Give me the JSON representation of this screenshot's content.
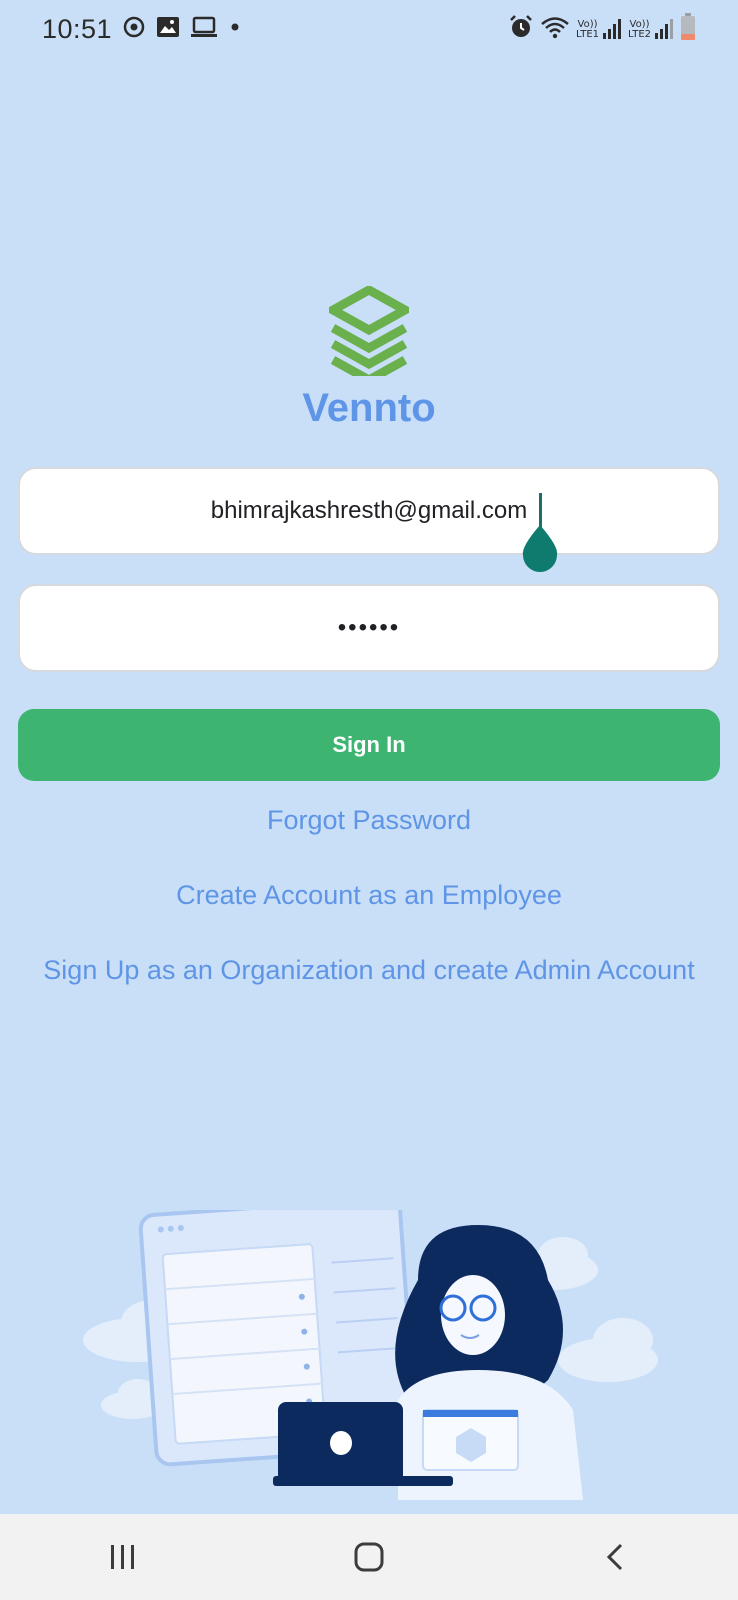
{
  "status_bar": {
    "time": "10:51",
    "left_icons": [
      "sync-icon",
      "image-icon",
      "laptop-icon",
      "dot-icon"
    ],
    "right_icons": [
      "alarm-icon",
      "wifi-icon",
      "signal-lte1-icon",
      "signal-lte2-icon",
      "battery-icon"
    ],
    "lte1_label": "Vo))\nLTE1",
    "lte2_label": "Vo))\nLTE2"
  },
  "brand": {
    "name": "Vennto",
    "logo_icon": "layers-icon",
    "logo_color": "#6ab04c"
  },
  "form": {
    "email_value": "bhimrajkashresth@gmail.com",
    "password_value": "••••••",
    "signin_label": "Sign In"
  },
  "links": {
    "forgot_password": "Forgot Password",
    "create_employee": "Create Account as an Employee",
    "signup_org": "Sign Up as an Organization and create Admin Account"
  },
  "illustration": {
    "icon": "woman-with-laptop-illustration"
  },
  "colors": {
    "background": "#c9dff8",
    "accent_blue": "#5f95e6",
    "button_green": "#3db571",
    "logo_green": "#6ab04c"
  },
  "nav_bar": {
    "buttons": [
      "recent-apps-icon",
      "home-icon",
      "back-icon"
    ]
  }
}
